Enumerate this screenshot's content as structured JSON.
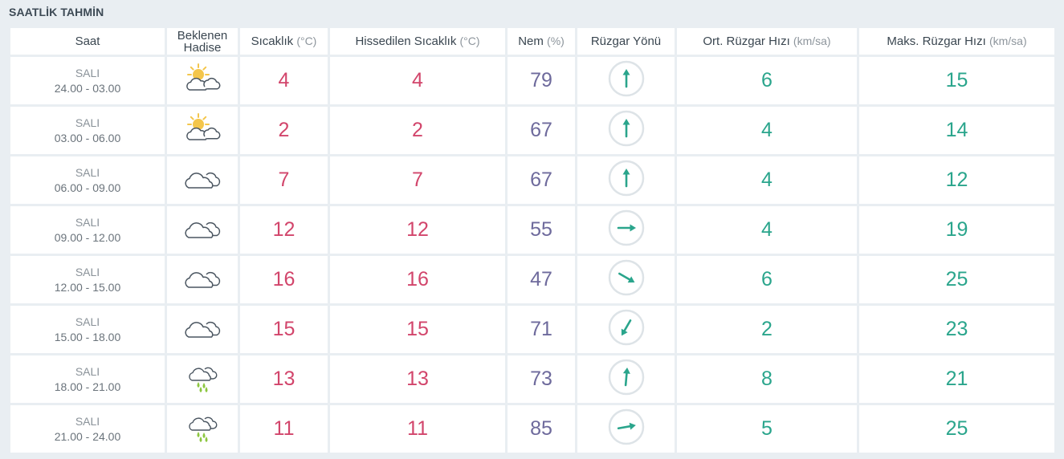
{
  "section_title": "SAATLİK TAHMİN",
  "headers": {
    "time": "Saat",
    "event_line1": "Beklenen",
    "event_line2": "Hadise",
    "temp_label": "Sıcaklık",
    "temp_unit": "(°C)",
    "feels_label": "Hissedilen Sıcaklık",
    "feels_unit": "(°C)",
    "hum_label": "Nem",
    "hum_unit": "(%)",
    "wind_dir": "Rüzgar Yönü",
    "avg_wind_label": "Ort. Rüzgar Hızı",
    "avg_wind_unit": "(km/sa)",
    "max_wind_label": "Maks. Rüzgar Hızı",
    "max_wind_unit": "(km/sa)"
  },
  "colors": {
    "temperature": "#d2456b",
    "humidity": "#6e6a9c",
    "wind": "#2aa58c",
    "sun": "#f4c64b",
    "cloud_outline": "#4a5560",
    "rain": "#8cc63f"
  },
  "rows": [
    {
      "day": "SALI",
      "range": "24.00 - 03.00",
      "icon": "partly-sunny-icon",
      "temp": "4",
      "feels": "4",
      "humidity": "79",
      "wind_dir_deg": 0,
      "avg_wind": "6",
      "max_wind": "15"
    },
    {
      "day": "SALI",
      "range": "03.00 - 06.00",
      "icon": "partly-sunny-icon",
      "temp": "2",
      "feels": "2",
      "humidity": "67",
      "wind_dir_deg": 0,
      "avg_wind": "4",
      "max_wind": "14"
    },
    {
      "day": "SALI",
      "range": "06.00 - 09.00",
      "icon": "cloudy-icon",
      "temp": "7",
      "feels": "7",
      "humidity": "67",
      "wind_dir_deg": 0,
      "avg_wind": "4",
      "max_wind": "12"
    },
    {
      "day": "SALI",
      "range": "09.00 - 12.00",
      "icon": "cloudy-icon",
      "temp": "12",
      "feels": "12",
      "humidity": "55",
      "wind_dir_deg": 90,
      "avg_wind": "4",
      "max_wind": "19"
    },
    {
      "day": "SALI",
      "range": "12.00 - 15.00",
      "icon": "cloudy-icon",
      "temp": "16",
      "feels": "16",
      "humidity": "47",
      "wind_dir_deg": 120,
      "avg_wind": "6",
      "max_wind": "25"
    },
    {
      "day": "SALI",
      "range": "15.00 - 18.00",
      "icon": "cloudy-icon",
      "temp": "15",
      "feels": "15",
      "humidity": "71",
      "wind_dir_deg": 210,
      "avg_wind": "2",
      "max_wind": "23"
    },
    {
      "day": "SALI",
      "range": "18.00 - 21.00",
      "icon": "rain-icon",
      "temp": "13",
      "feels": "13",
      "humidity": "73",
      "wind_dir_deg": 5,
      "avg_wind": "8",
      "max_wind": "21"
    },
    {
      "day": "SALI",
      "range": "21.00 - 24.00",
      "icon": "rain-icon",
      "temp": "11",
      "feels": "11",
      "humidity": "85",
      "wind_dir_deg": 80,
      "avg_wind": "5",
      "max_wind": "25"
    }
  ]
}
